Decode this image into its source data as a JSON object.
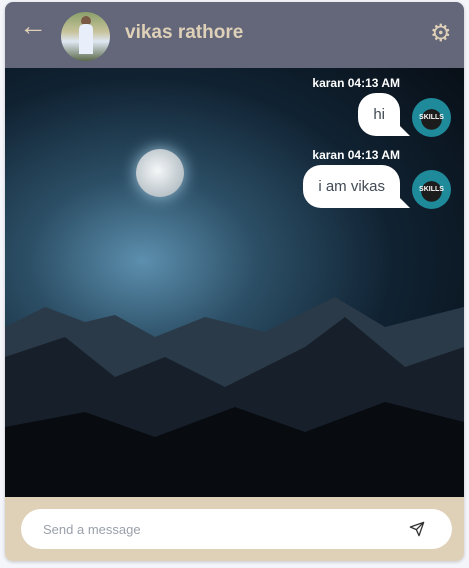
{
  "header": {
    "back_icon": "arrow-left-icon",
    "contact_name": "vikas rathore",
    "settings_icon": "gear-icon"
  },
  "messages": [
    {
      "sender": "karan",
      "time": "04:13 AM",
      "meta": "karan 04:13 AM",
      "text": "hi"
    },
    {
      "sender": "karan",
      "time": "04:13 AM",
      "meta": "karan 04:13 AM",
      "text": "i am vikas"
    }
  ],
  "avatar_logo_text": "SKILLS",
  "composer": {
    "placeholder": "Send a message",
    "value": "",
    "send_icon": "paper-plane-icon"
  },
  "colors": {
    "header": "#636779",
    "accent": "#dfd0b8",
    "bubble": "#ffffff"
  }
}
